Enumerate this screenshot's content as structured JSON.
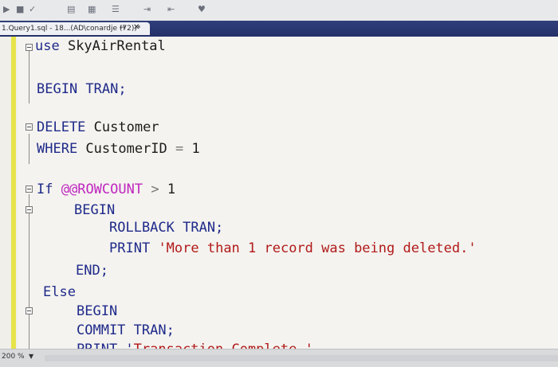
{
  "toolbar": {
    "icons": [
      "execute-icon",
      "debug-icon",
      "parse-icon",
      "results-icon",
      "comment-icon",
      "indent-icon",
      "specify-values-icon"
    ]
  },
  "tab": {
    "title": "1.Query1.sql - 18...(AD\\conardje (72))*",
    "pin_glyph": "↔",
    "close_glyph": "✕"
  },
  "code": {
    "l1_kw": "use",
    "l1_txt": " SkyAirRental",
    "l2": "BEGIN TRAN;",
    "l3_kw": "DELETE",
    "l3_txt": " Customer",
    "l4_kw": "WHERE",
    "l4_txt": " CustomerID ",
    "l4_op": "=",
    "l4_num": " 1",
    "l5_kw": "If",
    "l5_sys": "@@ROWCOUNT",
    "l5_op": ">",
    "l5_num": " 1",
    "l6": "BEGIN",
    "l7": "ROLLBACK TRAN;",
    "l8_kw": "PRINT",
    "l8_str": "'More than 1 record was being deleted.'",
    "l9": "END;",
    "l10": "Else",
    "l11": "BEGIN",
    "l12": "COMMIT TRAN;",
    "l13": "PRINT '",
    "l13_str": "Transaction Complete.'"
  },
  "status": {
    "zoom": "200 %"
  }
}
